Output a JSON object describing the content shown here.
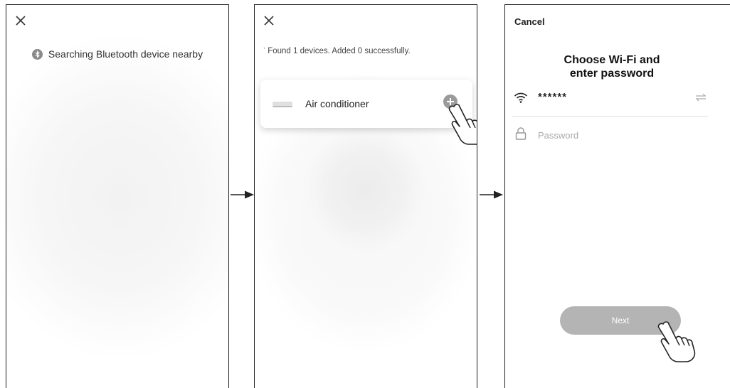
{
  "step1": {
    "close_icon": "close-icon",
    "bluetooth_icon": "bluetooth-icon",
    "status_text": "Searching Bluetooth device nearby"
  },
  "step2": {
    "close_icon": "close-icon",
    "found_text": "Found 1 devices. Added 0 successfully.",
    "device": {
      "name": "Air conditioner",
      "icon": "air-conditioner-icon",
      "add_icon": "plus-circle-icon"
    },
    "pointer_icon": "pointing-hand-icon"
  },
  "step3": {
    "cancel_label": "Cancel",
    "title_line1": "Choose Wi-Fi and",
    "title_line2": "enter password",
    "wifi_icon": "wifi-icon",
    "wifi_name": "******",
    "switch_icon": "switch-network-icon",
    "lock_icon": "lock-icon",
    "password_placeholder": "Password",
    "password_value": "",
    "next_label": "Next",
    "pointer_icon": "pointing-hand-icon"
  },
  "colors": {
    "next_button": "#b4b4b4",
    "add_button": "#9a9a9a",
    "glow": "#f4f4f4"
  }
}
